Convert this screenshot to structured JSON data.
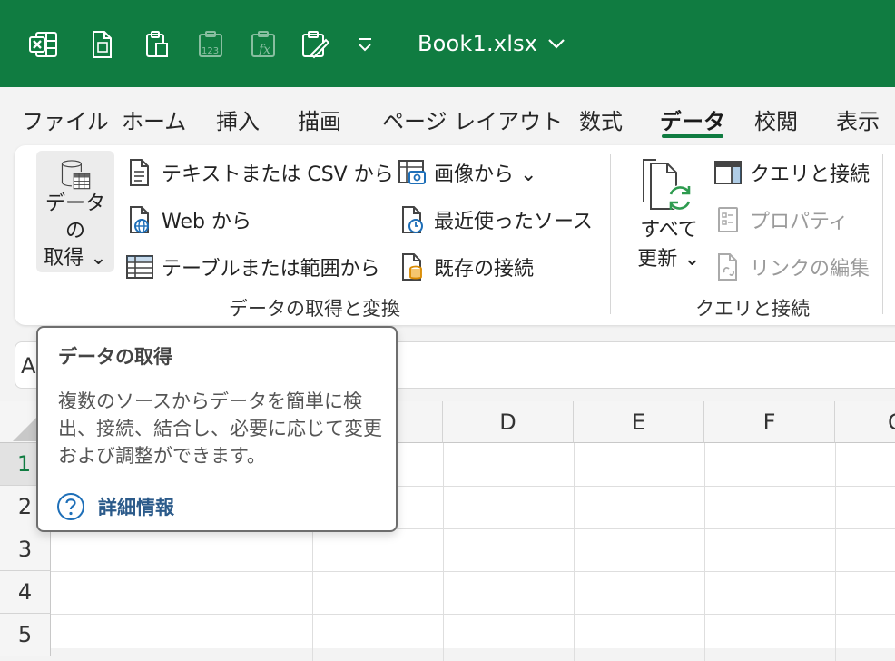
{
  "titlebar": {
    "file_name": "Book1.xlsx",
    "icons": [
      "excel-logo-icon",
      "new-file-icon",
      "clipboard-icon",
      "number-format-icon",
      "function-icon",
      "paste-special-icon",
      "customize-toolbar-icon"
    ]
  },
  "tabs": [
    {
      "label": "ファイル"
    },
    {
      "label": "ホーム"
    },
    {
      "label": "挿入"
    },
    {
      "label": "描画"
    },
    {
      "label": "ページ レイアウト"
    },
    {
      "label": "数式"
    },
    {
      "label": "データ",
      "active": true
    },
    {
      "label": "校閲"
    },
    {
      "label": "表示"
    }
  ],
  "ribbon": {
    "get_data": {
      "line1": "データの",
      "line2": "取得 ⌄"
    },
    "text_csv": "テキストまたは CSV から",
    "web": "Web から",
    "table_range": "テーブルまたは範囲から",
    "from_picture": "画像から ⌄",
    "recent_sources": "最近使ったソース",
    "existing_connections": "既存の接続",
    "group1_label": "データの取得と変換",
    "refresh_all": {
      "line1": "すべて",
      "line2": "更新 ⌄"
    },
    "queries_connections": "クエリと接続",
    "properties": "プロパティ",
    "edit_links": "リンクの編集",
    "group2_label": "クエリと接続"
  },
  "formula_bar": {
    "name_box_value": "A"
  },
  "grid": {
    "columns": [
      "D",
      "E",
      "F",
      "G"
    ],
    "rows": [
      "1",
      "2",
      "3",
      "4",
      "5"
    ],
    "selected_row": "1"
  },
  "tooltip": {
    "title": "データの取得",
    "body": "複数のソースからデータを簡単に検出、接続、結合し、必要に応じて変更および調整ができます。",
    "help_link": "詳細情報"
  },
  "colors": {
    "accent": "#107c41",
    "link": "#2b5a8a",
    "disabled": "#9a9a9a"
  }
}
